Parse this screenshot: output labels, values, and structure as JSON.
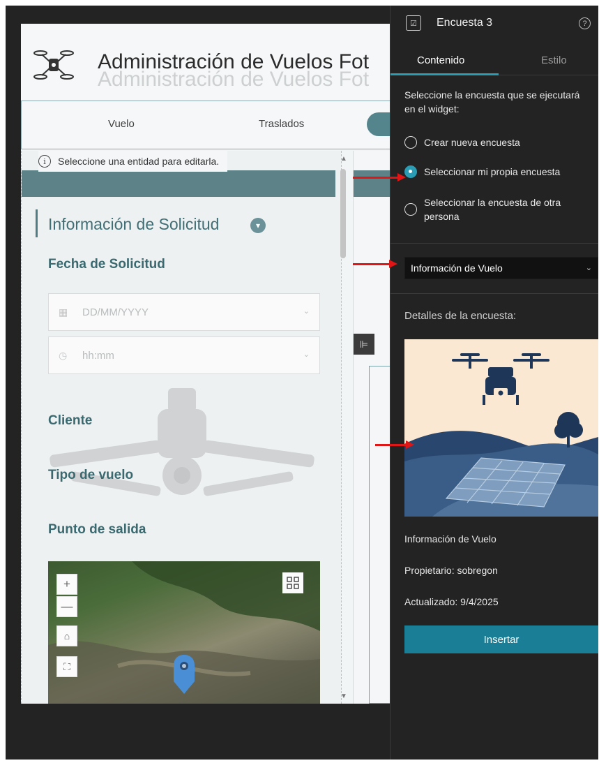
{
  "app": {
    "title": "Administración de Vuelos Fot",
    "title_ghost": "Administración de Vuelos Fot"
  },
  "nav": {
    "items": [
      {
        "label": "Vuelo"
      },
      {
        "label": "Traslados"
      }
    ]
  },
  "form": {
    "notice": "Seleccione una entidad para editarla.",
    "section_title": "Información de Solicitud",
    "fields": {
      "fecha": "Fecha de Solicitud",
      "date_placeholder": "DD/MM/YYYY",
      "time_placeholder": "hh:mm",
      "cliente": "Cliente",
      "tipo": "Tipo de vuelo",
      "punto": "Punto de salida"
    },
    "map": {
      "zoom_in": "+",
      "zoom_out": "—",
      "home": "⌂",
      "fullscreen": "⛶"
    }
  },
  "panel": {
    "title": "Encuesta 3",
    "help": "?",
    "tabs": [
      {
        "label": "Contenido",
        "active": true
      },
      {
        "label": "Estilo",
        "active": false
      }
    ],
    "select_prompt": "Seleccione la encuesta que se ejecutará en el widget:",
    "options": [
      {
        "label": "Crear nueva encuesta",
        "checked": false
      },
      {
        "label": "Seleccionar mi propia encuesta",
        "checked": true
      },
      {
        "label": "Seleccionar la encuesta de otra persona",
        "checked": false
      }
    ],
    "selected_survey": "Información de Vuelo",
    "details_title": "Detalles de la encuesta:",
    "survey_name": "Información de Vuelo",
    "owner": "Propietario: sobregon",
    "updated": "Actualizado: 9/4/2025",
    "insert_label": "Insertar"
  },
  "colors": {
    "accent": "#2a9db4",
    "insert_button": "#1a7f96",
    "teal_header": "#5d8288",
    "annotation_arrow": "#e01515"
  },
  "icons": [
    "drone-logo-icon",
    "info-icon",
    "calendar-icon",
    "clock-icon",
    "chevron-down-icon",
    "survey-icon",
    "help-icon",
    "map-pin-icon",
    "qr-icon",
    "home-icon",
    "fullscreen-icon"
  ]
}
